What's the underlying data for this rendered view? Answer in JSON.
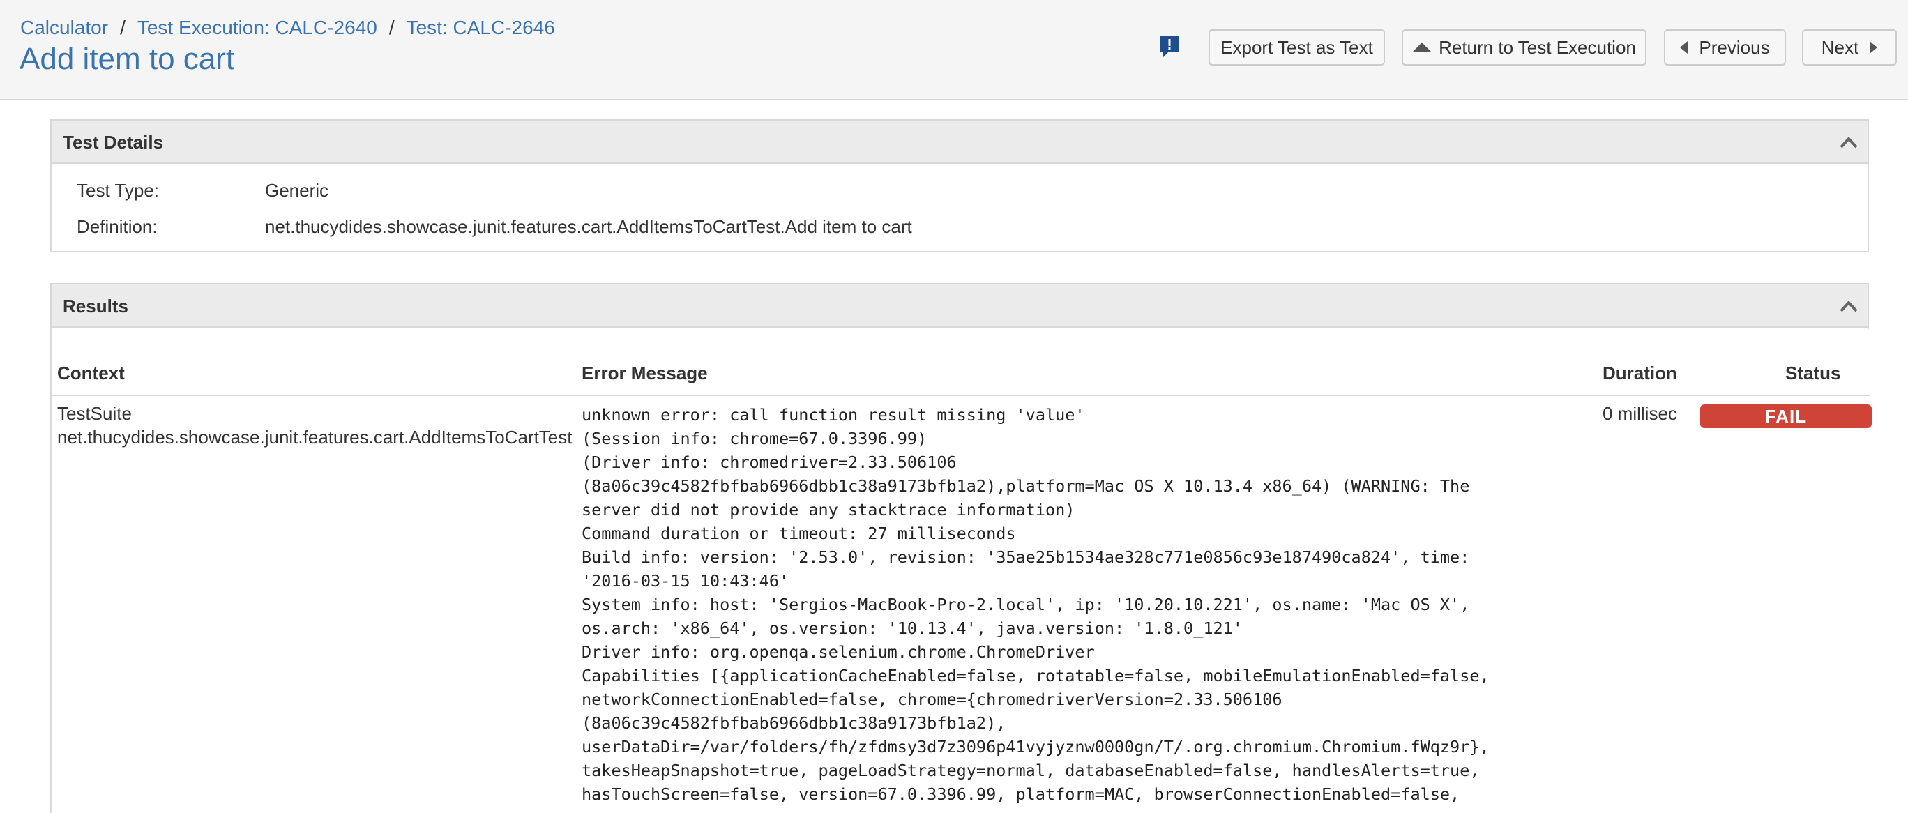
{
  "breadcrumb": {
    "items": [
      "Calculator",
      "Test Execution: CALC-2640",
      "Test: CALC-2646"
    ],
    "separator": "/"
  },
  "page_title": "Add item to cart",
  "toolbar": {
    "export_label": "Export Test as Text",
    "return_label": "Return to Test Execution",
    "previous_label": "Previous",
    "next_label": "Next",
    "feedback_icon": "feedback-icon"
  },
  "test_details": {
    "title": "Test Details",
    "rows": [
      {
        "label": "Test Type:",
        "value": "Generic"
      },
      {
        "label": "Definition:",
        "value": "net.thucydides.showcase.junit.features.cart.AddItemsToCartTest.Add item to cart"
      }
    ]
  },
  "results": {
    "title": "Results",
    "columns": {
      "context": "Context",
      "error": "Error Message",
      "duration": "Duration",
      "status": "Status"
    },
    "row": {
      "context_line1": "TestSuite",
      "context_line2": "net.thucydides.showcase.junit.features.cart.AddItemsToCartTest",
      "error_message": "unknown error: call function result missing 'value'\n(Session info: chrome=67.0.3396.99)\n(Driver info: chromedriver=2.33.506106\n(8a06c39c4582fbfbab6966dbb1c38a9173bfb1a2),platform=Mac OS X 10.13.4 x86_64) (WARNING: The\nserver did not provide any stacktrace information)\nCommand duration or timeout: 27 milliseconds\nBuild info: version: '2.53.0', revision: '35ae25b1534ae328c771e0856c93e187490ca824', time:\n'2016-03-15 10:43:46'\nSystem info: host: 'Sergios-MacBook-Pro-2.local', ip: '10.20.10.221', os.name: 'Mac OS X',\nos.arch: 'x86_64', os.version: '10.13.4', java.version: '1.8.0_121'\nDriver info: org.openqa.selenium.chrome.ChromeDriver\nCapabilities [{applicationCacheEnabled=false, rotatable=false, mobileEmulationEnabled=false,\nnetworkConnectionEnabled=false, chrome={chromedriverVersion=2.33.506106\n(8a06c39c4582fbfbab6966dbb1c38a9173bfb1a2),\nuserDataDir=/var/folders/fh/zfdmsy3d7z3096p41vyjyznw0000gn/T/.org.chromium.Chromium.fWqz9r},\ntakesHeapSnapshot=true, pageLoadStrategy=normal, databaseEnabled=false, handlesAlerts=true,\nhasTouchScreen=false, version=67.0.3396.99, platform=MAC, browserConnectionEnabled=false,",
      "duration": "0 millisec",
      "status": "FAIL"
    }
  },
  "colors": {
    "link": "#3b73af",
    "fail": "#d04437",
    "header_bg": "#f5f5f5",
    "panel_header_bg": "#ebebeb",
    "feedback_icon": "#1f4e8c"
  }
}
